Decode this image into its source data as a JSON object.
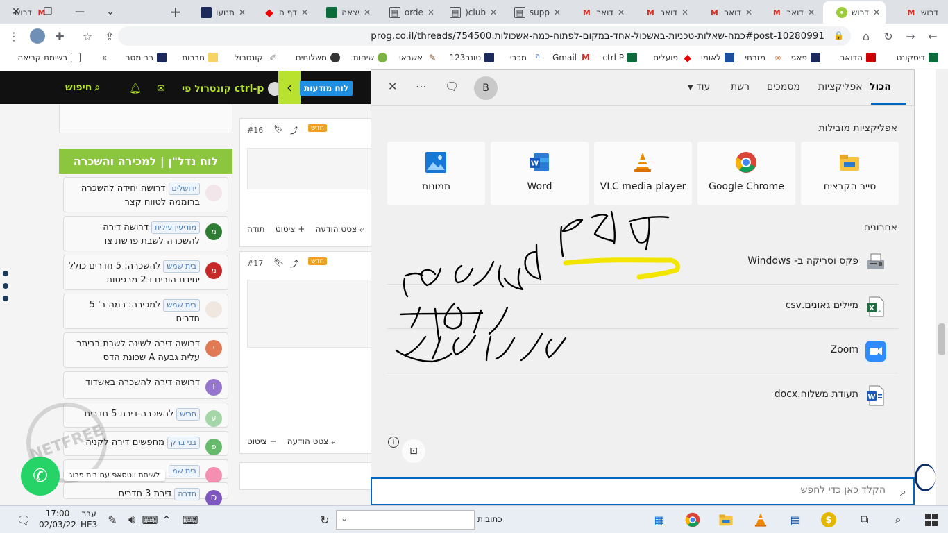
{
  "browser": {
    "tabs": [
      {
        "label": "דרוש",
        "icon": "gmail-icon",
        "active": false
      },
      {
        "label": "דרוש",
        "icon": "yad2-icon",
        "active": true
      },
      {
        "label": "דואר",
        "icon": "gmail-icon",
        "active": false
      },
      {
        "label": "דואר",
        "icon": "gmail-icon",
        "active": false
      },
      {
        "label": "דואר",
        "icon": "gmail-icon",
        "active": false
      },
      {
        "label": "דואר",
        "icon": "gmail-icon",
        "active": false
      },
      {
        "label": "supp",
        "icon": "page-icon",
        "active": false
      },
      {
        "label": "club(",
        "icon": "page-icon",
        "active": false
      },
      {
        "label": "orde",
        "icon": "page-icon",
        "active": false
      },
      {
        "label": "יצאה",
        "icon": "bank-icon",
        "active": false
      },
      {
        "label": "דף ה",
        "icon": "red-diamond-icon",
        "active": false
      },
      {
        "label": "תנועו",
        "icon": "bank-icon",
        "active": false
      }
    ],
    "url": "prog.co.il/threads/754500.כמה-שאלות-טכניות-באשכול-אחד-במקום-לפתוח-כמה-אשכולות#post-10280991",
    "bookmarks": [
      "דיסקונט",
      "הדואר",
      "פאגי",
      "מזרחי",
      "לאומי",
      "פועלים",
      "ctrl P",
      "Gmail",
      "מכבי",
      "טונר123",
      "אשראי",
      "שיחות",
      "משלוחים",
      "קונטרול",
      "חברות",
      "רב מסר",
      "רשימת קריאה"
    ]
  },
  "site": {
    "search_label": "חיפוש",
    "brand": "ctrl-p קונטרול פי",
    "news_button": "לוח מודעות",
    "sidebar_title": "לוח נדל\"ן | למכירה והשכרה",
    "listings": [
      {
        "tag": "ירושלים",
        "text": "דרושה יחידה להשכרה ברוממה לטווח קצר",
        "avatar": "",
        "color": "#f2e6ea"
      },
      {
        "tag": "מודיעין עילית",
        "text": "דרושה דירה להשכרה לשבת פרשת צו",
        "avatar": "מ",
        "color": "#2e7d32"
      },
      {
        "tag": "בית שמש",
        "text": "להשכרה: 5 חדרים כולל יחידת הורים ו-2 מרפסות",
        "avatar": "מ",
        "color": "#c62828"
      },
      {
        "tag": "בית שמש",
        "text": "למכירה: רמה ב' 5 חדרים",
        "avatar": "",
        "color": "#f0e8e0"
      },
      {
        "tag": "",
        "text": "דרושה דירה לשינה לשבת בביתר עלית גבעה A שכונת הדס",
        "avatar": "י",
        "color": "#e07a55"
      },
      {
        "tag": "",
        "text": "דרושה דירה להשכרה באשדוד",
        "avatar": "T",
        "color": "#9575cd"
      },
      {
        "tag": "חריש",
        "text": "להשכרה דירת 5 חדרים",
        "avatar": "ע",
        "color": "#a5d6a7"
      },
      {
        "tag": "בני ברק",
        "text": "מחפשים דירה לקניה",
        "avatar": "פ",
        "color": "#66bb6a"
      },
      {
        "tag": "בית שמ",
        "text": "",
        "avatar": "",
        "color": "#f48fb1"
      },
      {
        "tag": "חדרה",
        "text": "דירת 3 חדרים",
        "avatar": "D",
        "color": "#7e57c2"
      }
    ],
    "posts": [
      {
        "num": "#16",
        "badge": "חדש",
        "quote": "ציטוט",
        "reply": "צטט הודעה",
        "thanks": "תודה"
      },
      {
        "num": "#17",
        "badge": "חדש",
        "quote": "ציטוט",
        "reply": "צטט הודעה"
      }
    ],
    "whatsapp_label": "לשיחת ווטסאפ עם בית פרוג",
    "watermark": "NETFREE"
  },
  "search_panel": {
    "tabs": [
      "הכול",
      "אפליקציות",
      "מסמכים",
      "רשת",
      "עוד"
    ],
    "avatar_letter": "B",
    "pinned_title": "אפליקציות מובילות",
    "pinned_apps": [
      {
        "name": "סייר הקבצים",
        "icon": "file-explorer-icon"
      },
      {
        "name": "Google Chrome",
        "icon": "chrome-icon"
      },
      {
        "name": "VLC media player",
        "icon": "vlc-icon"
      },
      {
        "name": "Word",
        "icon": "word-icon"
      },
      {
        "name": "תמונות",
        "icon": "photos-icon"
      }
    ],
    "recent_title": "אחרונים",
    "recent": [
      {
        "name": "פקס וסריקה ב- Windows",
        "icon": "fax-icon"
      },
      {
        "name": "מיילים גאונים.csv",
        "icon": "excel-icon"
      },
      {
        "name": "Zoom",
        "icon": "zoom-icon"
      },
      {
        "name": "תעודת משלוח.docx",
        "icon": "word-doc-icon"
      }
    ],
    "search_placeholder": "הקלד כאן כדי לחפש",
    "handwriting_color": "#f2e600"
  },
  "taskbar": {
    "address_label": "כתובות",
    "time": "17:00",
    "date": "02/03/22",
    "lang": "עבר",
    "lang_sub": "HE3"
  }
}
